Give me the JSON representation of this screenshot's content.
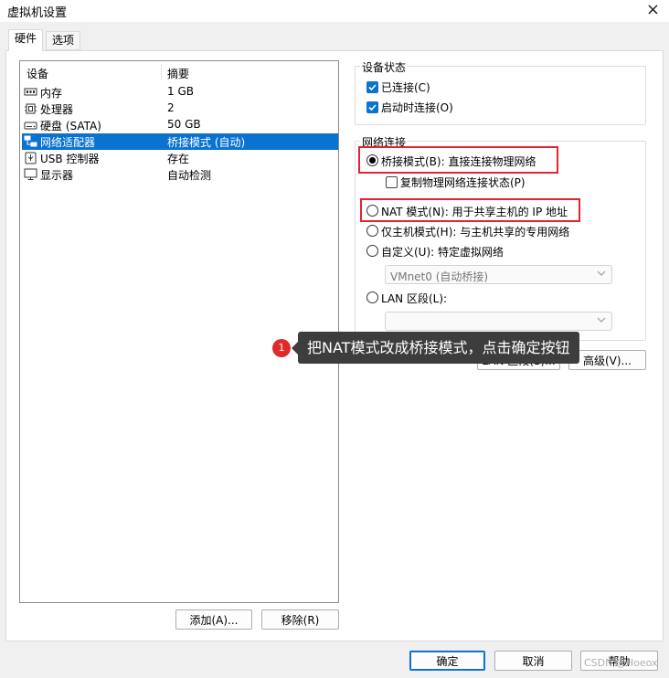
{
  "window": {
    "title": "虚拟机设置",
    "close_glyph": "×"
  },
  "tabs": [
    {
      "label": "硬件",
      "active": true
    },
    {
      "label": "选项",
      "active": false
    }
  ],
  "device_list": {
    "header_device": "设备",
    "header_summary": "摘要",
    "rows": [
      {
        "name": "内存",
        "summary": "1 GB",
        "icon": "memory-icon"
      },
      {
        "name": "处理器",
        "summary": "2",
        "icon": "cpu-icon"
      },
      {
        "name": "硬盘 (SATA)",
        "summary": "50 GB",
        "icon": "hard-disk-icon"
      },
      {
        "name": "网络适配器",
        "summary": "桥接模式 (自动)",
        "icon": "network-adapter-icon",
        "selected": true
      },
      {
        "name": "USB 控制器",
        "summary": "存在",
        "icon": "usb-icon"
      },
      {
        "name": "显示器",
        "summary": "自动检测",
        "icon": "monitor-icon"
      }
    ],
    "add_button": "添加(A)...",
    "remove_button": "移除(R)"
  },
  "device_status": {
    "label": "设备状态",
    "connected": "已连接(C)",
    "connect_on_power_on": "启动时连接(O)"
  },
  "network_connection": {
    "label": "网络连接",
    "bridged": "桥接模式(B): 直接连接物理网络",
    "replicate": "复制物理网络连接状态(P)",
    "nat": "NAT 模式(N): 用于共享主机的 IP 地址",
    "host_only": "仅主机模式(H): 与主机共享的专用网络",
    "custom": "自定义(U): 特定虚拟网络",
    "custom_select": "VMnet0 (自动桥接)",
    "lan_segment": "LAN 区段(L):",
    "lan_segment_select": "",
    "lan_segments_button": "LAN 区段(S)...",
    "advanced_button": "高级(V)..."
  },
  "footer": {
    "ok": "确定",
    "cancel": "取消",
    "help": "帮助"
  },
  "annotation": {
    "badge": "1",
    "text": "把NAT模式改成桥接模式，点击确定按钮"
  },
  "watermark": "CSDN @Hoeox",
  "colors": {
    "accent": "#0a72d1",
    "highlight_box": "#e0252f",
    "tooltip_bg": "#3d3d3d",
    "badge": "#e02a2a"
  }
}
